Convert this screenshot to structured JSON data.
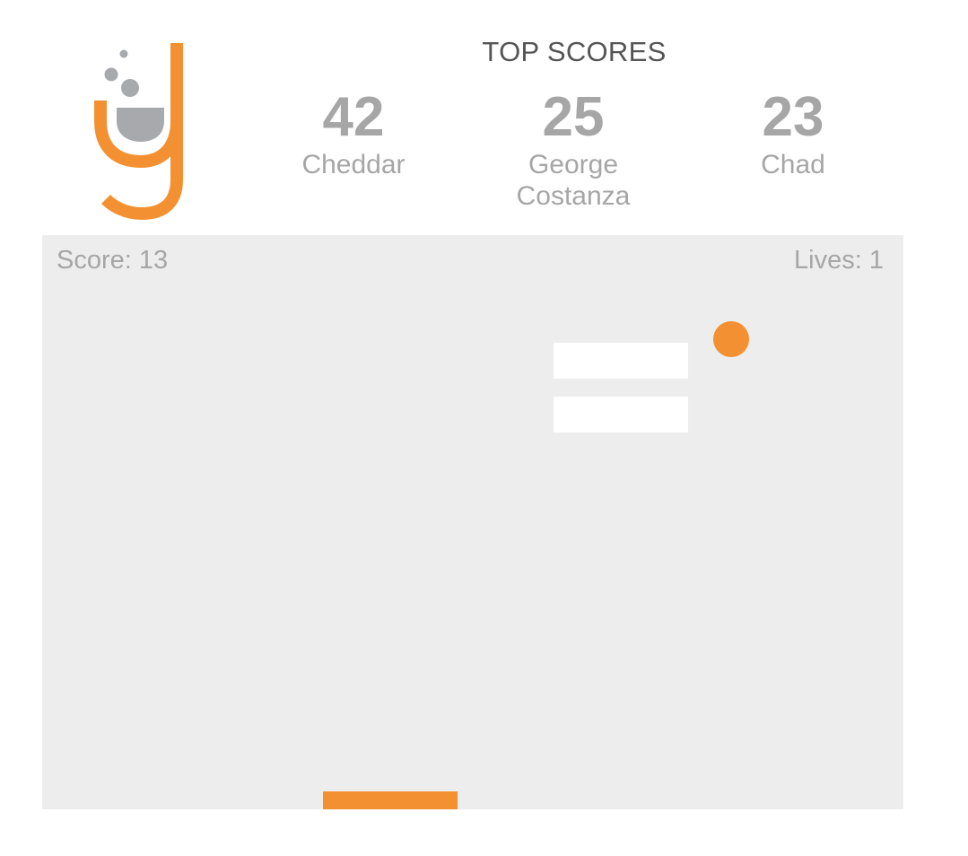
{
  "theme": {
    "accent": "#f39132",
    "text_gray": "#a6a6a6",
    "title_gray": "#555555",
    "board_bg": "#ededed",
    "logo_gray": "#a7a9ac"
  },
  "header": {
    "logo_icon": "bubbling-cup-letter-g-logo",
    "top_scores_title": "TOP SCORES",
    "top_scores": [
      {
        "score": "42",
        "name": "Cheddar"
      },
      {
        "score": "25",
        "name": "George Costanza"
      },
      {
        "score": "23",
        "name": "Chad"
      }
    ]
  },
  "game": {
    "score_label": "Score: 13",
    "lives_label": "Lives: 1",
    "bricks_remaining": 2,
    "ball_color": "#f39132",
    "paddle_color": "#f39132"
  }
}
